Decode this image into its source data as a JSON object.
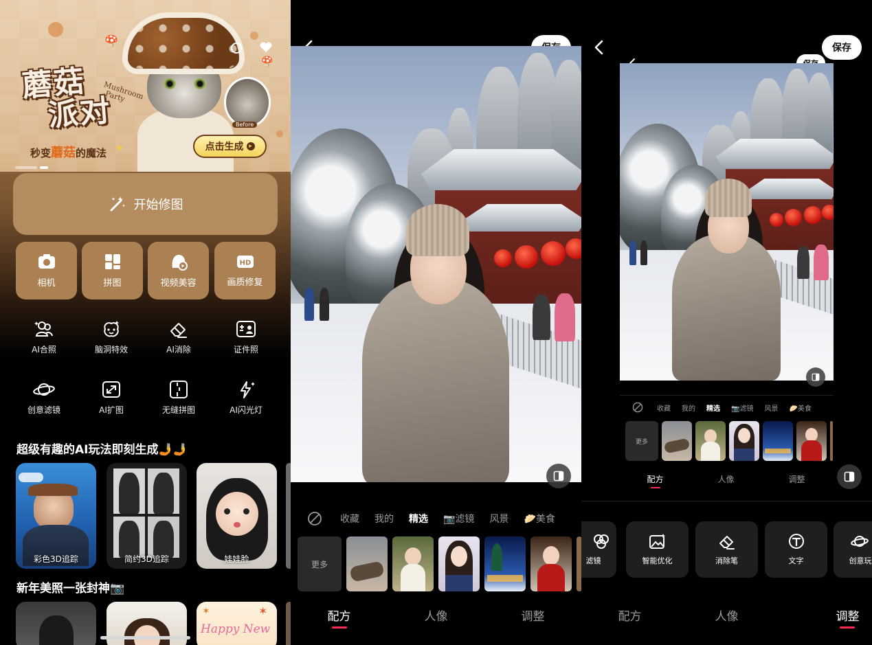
{
  "home": {
    "banner": {
      "title_line1": "蘑菇",
      "title_line2": "派对",
      "title_en_line1": "Mushroom",
      "title_en_line2": "Party",
      "subtitle_prefix": "秒变",
      "subtitle_highlight": "蘑菇",
      "subtitle_suffix": "的魔法",
      "before_label": "Before",
      "generate_button": "点击生成"
    },
    "start_button": "开始修图",
    "main_tiles": [
      {
        "label": "相机",
        "icon": "camera-icon"
      },
      {
        "label": "拼图",
        "icon": "collage-icon"
      },
      {
        "label": "视频美容",
        "icon": "video-beauty-icon"
      },
      {
        "label": "画质修复",
        "icon": "hd-icon"
      }
    ],
    "tools_row1": [
      {
        "label": "AI合照",
        "icon": "ai-group-photo-icon"
      },
      {
        "label": "脑洞特效",
        "icon": "brain-effect-icon"
      },
      {
        "label": "AI消除",
        "icon": "eraser-icon"
      },
      {
        "label": "证件照",
        "icon": "id-photo-icon"
      }
    ],
    "tools_row2": [
      {
        "label": "创意滤镜",
        "icon": "planet-icon"
      },
      {
        "label": "AI扩图",
        "icon": "expand-icon"
      },
      {
        "label": "无缝拼图",
        "icon": "seamless-collage-icon"
      },
      {
        "label": "AI闪光灯",
        "icon": "flash-icon"
      }
    ],
    "section1_title": "超级有趣的AI玩法即刻生成🤳🤳",
    "section1_cards": [
      {
        "label": "彩色3D追踪"
      },
      {
        "label": "简约3D追踪"
      },
      {
        "label": "娃娃脸"
      }
    ],
    "section2_title": "新年美照一张封神📷",
    "section2_card3_text": "Happy New"
  },
  "editor_presets": {
    "save_label": "保存",
    "filter_tabs": [
      "收藏",
      "我的",
      "精选",
      "📷滤镜",
      "风景",
      "🥟美食"
    ],
    "active_filter": "精选",
    "more_label": "更多",
    "bottom_tabs": [
      "配方",
      "人像",
      "调整"
    ],
    "active_bottom": "配方"
  },
  "editor_adjust": {
    "save_label": "保存",
    "inner_save_label": "保存",
    "filter_tabs": [
      "收藏",
      "我的",
      "精选",
      "📷滤镜",
      "风景",
      "🥟美食"
    ],
    "more_label": "更多",
    "inner_tabs": [
      "配方",
      "人像",
      "调整"
    ],
    "tools": [
      {
        "label": "滤镜",
        "icon": "filter-icon"
      },
      {
        "label": "智能优化",
        "icon": "smart-optimize-icon"
      },
      {
        "label": "消除笔",
        "icon": "eraser-pen-icon"
      },
      {
        "label": "文字",
        "icon": "text-icon"
      },
      {
        "label": "创意玩",
        "icon": "planet-icon"
      }
    ],
    "bottom_tabs": [
      "配方",
      "人像",
      "调整"
    ],
    "active_bottom": "调整"
  },
  "colors": {
    "accent_underline": "#ff2a55",
    "tile_brown": "#ab8154",
    "generate_yellow": "#f4d45a"
  }
}
